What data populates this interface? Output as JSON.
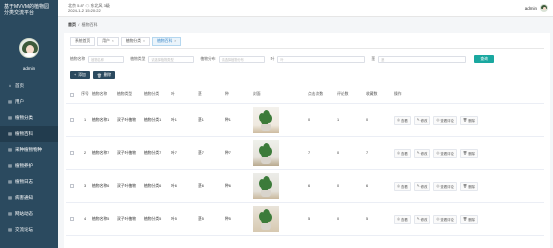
{
  "sidebar": {
    "brand_line1": "基于MVVM的植物园",
    "brand_line2": "分类交流平台",
    "admin_name": "admin",
    "items": [
      {
        "icon": "home-icon",
        "glyph": "⌂",
        "label": "首页",
        "active": false
      },
      {
        "icon": "user-icon",
        "glyph": "▤",
        "label": "用户",
        "active": false
      },
      {
        "icon": "plant-category-icon",
        "glyph": "▤",
        "label": "植物分类",
        "active": false
      },
      {
        "icon": "plant-info-icon",
        "glyph": "▤",
        "label": "植物百科",
        "active": true
      },
      {
        "icon": "collection-icon",
        "glyph": "▤",
        "label": "采种植物物种",
        "active": false
      },
      {
        "icon": "maintenance-icon",
        "glyph": "▤",
        "label": "植物养护",
        "active": false
      },
      {
        "icon": "log-icon",
        "glyph": "▤",
        "label": "植物日志",
        "active": false
      },
      {
        "icon": "notice-icon",
        "glyph": "▤",
        "label": "病害通知",
        "active": false
      },
      {
        "icon": "news-icon",
        "glyph": "▤",
        "label": "网站动态",
        "active": false
      },
      {
        "icon": "forum-icon",
        "glyph": "▤",
        "label": "交流论坛",
        "active": false
      }
    ]
  },
  "topbar": {
    "weather_line1": "北京 5.8° ☁ 东北风 3级",
    "weather_line2": "2024-1-2 15:20:22",
    "user": "admin"
  },
  "breadcrumb": {
    "home": "首页",
    "current": "植物百科"
  },
  "tabs": [
    {
      "label": "系统首页",
      "active": false,
      "closable": false
    },
    {
      "label": "用户",
      "active": false,
      "closable": true
    },
    {
      "label": "植物分类",
      "active": false,
      "closable": true
    },
    {
      "label": "植物百科",
      "active": true,
      "closable": true
    }
  ],
  "filters": [
    {
      "label": "植物名称",
      "placeholder": "植物名称",
      "width": 36
    },
    {
      "label": "植物类型",
      "placeholder": "请选择植物类型",
      "width": 46
    },
    {
      "label": "植物分布",
      "placeholder": "请选择植物分布",
      "width": 46
    },
    {
      "label": "叶",
      "placeholder": "叶",
      "width": 88
    },
    {
      "label": "茎",
      "placeholder": "茎",
      "width": 88
    }
  ],
  "search_button": "查询",
  "actions": {
    "add": "添加",
    "delete": "删除"
  },
  "table": {
    "headers": [
      "序号",
      "植物名称",
      "植物类型",
      "植物分类",
      "叶",
      "茎",
      "种",
      "封面",
      "点击次数",
      "评论数",
      "收藏数",
      "操作"
    ],
    "rows": [
      {
        "idx": "1",
        "name": "植物名称1",
        "type": "双子叶植物",
        "category": "植物分类1",
        "leaf": "叶1",
        "stem": "茎1",
        "seed": "种1",
        "clicks": "0",
        "comments": "1",
        "favorites": "0",
        "thumb": "p1"
      },
      {
        "idx": "2",
        "name": "植物名称7",
        "type": "双子叶植物",
        "category": "植物分类7",
        "leaf": "叶7",
        "stem": "茎7",
        "seed": "种7",
        "clicks": "7",
        "comments": "0",
        "favorites": "7",
        "thumb": "p2"
      },
      {
        "idx": "3",
        "name": "植物名称6",
        "type": "双子叶植物",
        "category": "植物分类6",
        "leaf": "叶6",
        "stem": "茎6",
        "seed": "种6",
        "clicks": "6",
        "comments": "0",
        "favorites": "6",
        "thumb": "p3"
      },
      {
        "idx": "4",
        "name": "植物名称5",
        "type": "双子叶植物",
        "category": "植物分类5",
        "leaf": "叶5",
        "stem": "茎5",
        "seed": "种5",
        "clicks": "5",
        "comments": "0",
        "favorites": "5",
        "thumb": "p4"
      }
    ],
    "ops": [
      {
        "icon": "view-icon",
        "glyph": "◎",
        "label": "查看"
      },
      {
        "icon": "edit-icon",
        "glyph": "✎",
        "label": "修改"
      },
      {
        "icon": "review-icon",
        "glyph": "◎",
        "label": "查看评论"
      },
      {
        "icon": "delete-icon",
        "glyph": "🗑",
        "label": "删除"
      }
    ]
  }
}
